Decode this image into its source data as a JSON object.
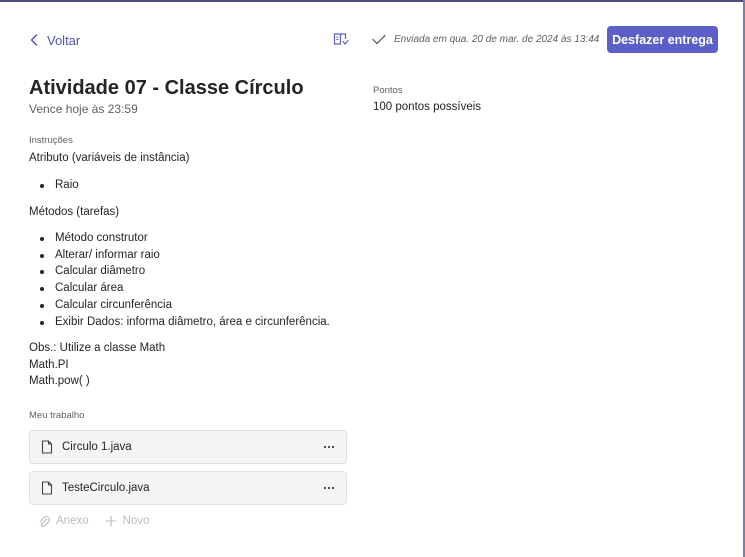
{
  "header": {
    "back_label": "Voltar",
    "status_text": "Enviada em qua. 20 de mar. de 2024 às 13:44",
    "undo_button": "Desfazer entrega"
  },
  "assignment": {
    "title": "Atividade 07 - Classe Círculo",
    "due": "Vence hoje às 23:59"
  },
  "instructions": {
    "label": "Instruções",
    "attributes_heading": "Atributo (variáveis de instância)",
    "attributes": [
      "Raio"
    ],
    "methods_heading": "Métodos (tarefas)",
    "methods": [
      "Método construtor",
      "Alterar/ informar raio",
      "Calcular diâmetro",
      "Calcular área",
      "Calcular circunferência",
      "Exibir Dados: informa diâmetro, área e circunferência."
    ],
    "obs_lines": [
      "Obs.: Utilize a classe Math",
      "Math.PI",
      "Math.pow( )"
    ]
  },
  "work": {
    "label": "Meu trabalho",
    "files": [
      {
        "name": "Circulo 1.java",
        "icon": "file-icon"
      },
      {
        "name": "TesteCirculo.java",
        "icon": "file-icon"
      }
    ],
    "attach_label": "Anexo",
    "new_label": "Novo"
  },
  "points": {
    "label": "Pontos",
    "value": "100 pontos possíveis"
  },
  "colors": {
    "accent": "#5b5fc7",
    "link": "#4f52b2",
    "muted": "#616161",
    "disabled": "#bdbdbd"
  }
}
